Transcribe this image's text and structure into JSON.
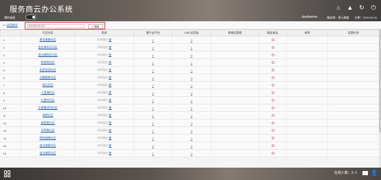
{
  "header": {
    "title": "服务商云办公系统",
    "nav_tab": "我的桌面",
    "user_name": "xiaoheiren",
    "org_label": "服务商：晋元南路",
    "date_label": "日期：2025-04-06",
    "icons": [
      "home-icon",
      "graduation-cap-icon",
      "refresh-icon",
      "power-icon"
    ]
  },
  "toolbar": {
    "back_prefix": "<<",
    "back_link": "返回首页",
    "search_placeholder": "报告服务商名称",
    "search_button": "搜索"
  },
  "table": {
    "columns": [
      "",
      "片区社区",
      "状态",
      "客户云平台",
      "CMC应用站",
      "商城运营商",
      "服务商云",
      "未明",
      "定期任务"
    ],
    "status_text": "关联服务",
    "status_link": "查",
    "rows": [
      {
        "idx": "1",
        "name": "建设南路社区",
        "platform": "0",
        "cmc": "0"
      },
      {
        "idx": "2",
        "name": "信达城东区社区",
        "platform": "0",
        "cmc": "1"
      },
      {
        "idx": "3",
        "name": "信达城西区社区",
        "platform": "0",
        "cmc": "0"
      },
      {
        "idx": "4",
        "name": "农科院社区",
        "platform": "0",
        "cmc": "1"
      },
      {
        "idx": "5",
        "name": "农家花园社区",
        "platform": "0",
        "cmc": "0"
      },
      {
        "idx": "6",
        "name": "天霸普新社区",
        "platform": "4",
        "cmc": "0"
      },
      {
        "idx": "7",
        "name": "青坛社区",
        "platform": "0",
        "cmc": "0"
      },
      {
        "idx": "8",
        "name": "十里铺社区",
        "platform": "0",
        "cmc": "0"
      },
      {
        "idx": "9",
        "name": "七里村社区",
        "platform": "0",
        "cmc": "0"
      },
      {
        "idx": "10",
        "name": "北城镇滨河社区",
        "platform": "1",
        "cmc": "1"
      },
      {
        "idx": "11",
        "name": "海恩社区",
        "platform": "0",
        "cmc": "0"
      },
      {
        "idx": "12",
        "name": "城里管社区",
        "platform": "0",
        "cmc": "0"
      },
      {
        "idx": "13",
        "name": "百草春社区",
        "platform": "1",
        "cmc": "0"
      },
      {
        "idx": "14",
        "name": "明经城南社区",
        "platform": "0",
        "cmc": "0"
      },
      {
        "idx": "15",
        "name": "信达城星社区",
        "platform": "0",
        "cmc": "0"
      },
      {
        "idx": "16",
        "name": "信达城西社区",
        "platform": "0",
        "cmc": "0"
      }
    ]
  },
  "footer": {
    "online_count": "在线人数：3 人"
  }
}
